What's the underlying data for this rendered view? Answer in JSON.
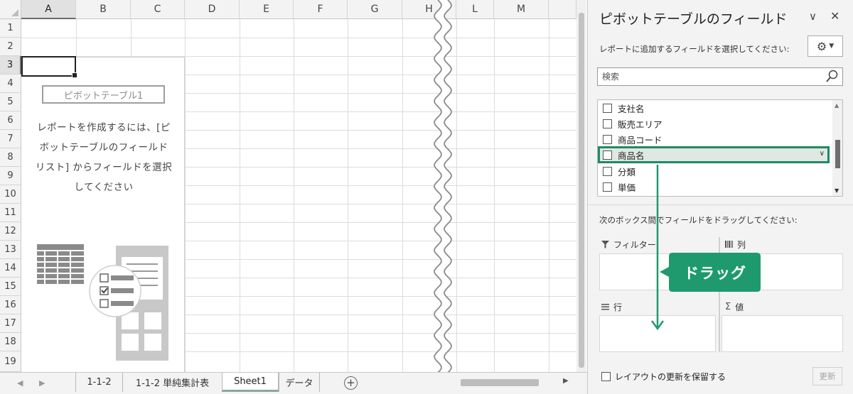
{
  "sheet": {
    "columns": [
      "A",
      "B",
      "C",
      "D",
      "E",
      "F",
      "G",
      "H",
      "L",
      "M"
    ],
    "selected_column": "A",
    "rows": [
      "1",
      "2",
      "3",
      "4",
      "5",
      "6",
      "7",
      "8",
      "9",
      "10",
      "11",
      "12",
      "13",
      "14",
      "15",
      "16",
      "17",
      "18",
      "19"
    ],
    "selected_row": "3",
    "pivot_placeholder": {
      "title": "ピボットテーブル1",
      "message_lines": [
        "レポートを作成するには、[ピ",
        "ボットテーブルのフィールド",
        "リスト] からフィールドを選択",
        "してください"
      ]
    },
    "tabs": [
      "1-1-2",
      "1-1-2 単純集計表",
      "Sheet1",
      "データ"
    ],
    "active_tab": "Sheet1",
    "nav_prev": "◀",
    "nav_next": "▶",
    "add_tab": "+"
  },
  "pane": {
    "title": "ピボットテーブルのフィールド",
    "collapse_glyph": "∨",
    "close_glyph": "✕",
    "subtitle": "レポートに追加するフィールドを選択してください:",
    "search_placeholder": "検索",
    "fields": [
      {
        "label": "支社名",
        "checked": false
      },
      {
        "label": "販売エリア",
        "checked": false
      },
      {
        "label": "商品コード",
        "checked": false
      },
      {
        "label": "商品名",
        "checked": false,
        "highlighted": true
      },
      {
        "label": "分類",
        "checked": false
      },
      {
        "label": "単価",
        "checked": false
      }
    ],
    "areas_label": "次のボックス間でフィールドをドラッグしてください:",
    "areas": {
      "filter": "フィルター",
      "columns": "列",
      "rows": "行",
      "values": "値"
    },
    "defer_label": "レイアウトの更新を保留する",
    "update_button": "更新"
  },
  "annotation": {
    "callout_text": "ドラッグ",
    "accent_color": "#1f9a6e"
  }
}
